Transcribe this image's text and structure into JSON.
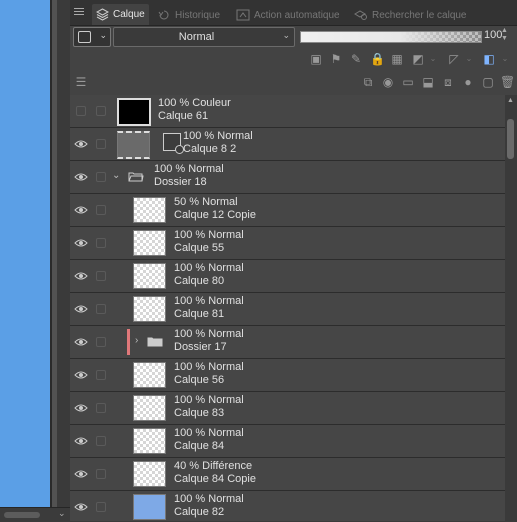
{
  "tabs": [
    {
      "label": "Calque",
      "icon": "layers-icon",
      "active": true
    },
    {
      "label": "Historique",
      "icon": "history-icon",
      "active": false
    },
    {
      "label": "Action automatique",
      "icon": "auto-action-icon",
      "active": false
    },
    {
      "label": "Rechercher le calque",
      "icon": "search-layer-icon",
      "active": false
    }
  ],
  "toolbar": {
    "blend_mode": "Normal",
    "opacity_value": "100",
    "opacity_level_percent": 100
  },
  "layers": [
    {
      "opacity_mode": "100 % Couleur",
      "name": "Calque 61",
      "visible": false,
      "kind": "fill-black"
    },
    {
      "opacity_mode": "100 % Normal",
      "name": "Calque 8 2",
      "visible": true,
      "kind": "masked"
    },
    {
      "opacity_mode": "100 % Normal",
      "name": "Dossier 18",
      "visible": true,
      "kind": "folder-open"
    },
    {
      "opacity_mode": "50 % Normal",
      "name": "Calque 12 Copie",
      "visible": true,
      "kind": "raster"
    },
    {
      "opacity_mode": "100 % Normal",
      "name": "Calque 55",
      "visible": true,
      "kind": "raster"
    },
    {
      "opacity_mode": "100 % Normal",
      "name": "Calque 80",
      "visible": true,
      "kind": "raster"
    },
    {
      "opacity_mode": "100 % Normal",
      "name": "Calque 81",
      "visible": true,
      "kind": "raster"
    },
    {
      "opacity_mode": "100 % Normal",
      "name": "Dossier 17",
      "visible": true,
      "kind": "folder-closed",
      "color_tag": "#e0787a"
    },
    {
      "opacity_mode": "100 % Normal",
      "name": "Calque 56",
      "visible": true,
      "kind": "raster"
    },
    {
      "opacity_mode": "100 % Normal",
      "name": "Calque 83",
      "visible": true,
      "kind": "raster"
    },
    {
      "opacity_mode": "100 % Normal",
      "name": "Calque 84",
      "visible": true,
      "kind": "raster"
    },
    {
      "opacity_mode": "40 % Différence",
      "name": "Calque 84 Copie",
      "visible": true,
      "kind": "raster"
    },
    {
      "opacity_mode": "100 % Normal",
      "name": "Calque 82",
      "visible": true,
      "kind": "fill-blue"
    }
  ],
  "colors": {
    "canvas_fill": "#5b9fe6",
    "folder_color_tag": "#e0787a",
    "panel_bg": "#434343"
  }
}
